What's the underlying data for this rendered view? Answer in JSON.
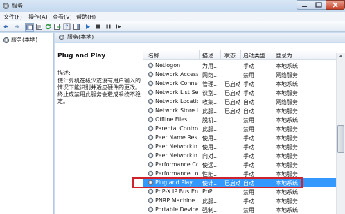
{
  "window": {
    "title": "服务"
  },
  "menu": [
    "文件(F)",
    "操作(A)",
    "查看(V)",
    "帮助(H)"
  ],
  "toolbar": {
    "icons": [
      "back-icon",
      "forward-icon",
      "console-tree-icon",
      "properties-icon",
      "refresh-icon",
      "export-icon",
      "help-icon",
      "show-hide-icon",
      "play-icon",
      "stop-icon",
      "pause-icon",
      "restart-icon"
    ]
  },
  "tree": {
    "label": "服务(本地)"
  },
  "header": {
    "title": "服务(本地)"
  },
  "details": {
    "title": "Plug and Play",
    "desc_label": "描述:",
    "description": "使计算机在极少或没有用户输入的情况下能识别并适应硬件的更改。终止或禁用此服务会造成系统不稳定。"
  },
  "columns": [
    "名称",
    "描述",
    "状态",
    "启动类型",
    "登录为"
  ],
  "rows": [
    {
      "name": "Netlogon",
      "desc": "为用...",
      "status": "",
      "startup": "手动",
      "logon": "本地系统"
    },
    {
      "name": "Network Access ...",
      "desc": "网络...",
      "status": "",
      "startup": "禁用",
      "logon": "网络服务"
    },
    {
      "name": "Network Connec...",
      "desc": "管理...",
      "status": "已启动",
      "startup": "手动",
      "logon": "本地系统"
    },
    {
      "name": "Network List Ser...",
      "desc": "识别...",
      "status": "已启动",
      "startup": "手动",
      "logon": "本地服务"
    },
    {
      "name": "Network Locatio...",
      "desc": "收集...",
      "status": "已启动",
      "startup": "自动",
      "logon": "网络服务"
    },
    {
      "name": "Network Store I...",
      "desc": "此服...",
      "status": "已启动",
      "startup": "自动",
      "logon": "本地服务"
    },
    {
      "name": "Offline Files",
      "desc": "脱机...",
      "status": "",
      "startup": "禁用",
      "logon": "本地系统"
    },
    {
      "name": "Parental Controls",
      "desc": "此服...",
      "status": "",
      "startup": "禁用",
      "logon": "本地服务"
    },
    {
      "name": "Peer Name Res...",
      "desc": "使用...",
      "status": "",
      "startup": "手动",
      "logon": "本地服务"
    },
    {
      "name": "Peer Networkin...",
      "desc": "使用...",
      "status": "",
      "startup": "手动",
      "logon": "本地服务"
    },
    {
      "name": "Peer Networkin...",
      "desc": "向对...",
      "status": "",
      "startup": "手动",
      "logon": "本地服务"
    },
    {
      "name": "Performance Co...",
      "desc": "使远...",
      "status": "",
      "startup": "手动",
      "logon": "本地服务"
    },
    {
      "name": "Performance Lo...",
      "desc": "性能...",
      "status": "",
      "startup": "手动",
      "logon": "本地服务"
    },
    {
      "name": "Plug and Play",
      "desc": "使计...",
      "status": "已启动",
      "startup": "自动",
      "logon": "本地系统"
    },
    {
      "name": "PnP-X IP Bus En...",
      "desc": "PnP...",
      "status": "",
      "startup": "禁用",
      "logon": "本地系统"
    },
    {
      "name": "PNRP Machine ...",
      "desc": "此服...",
      "status": "",
      "startup": "手动",
      "logon": "本地服务"
    },
    {
      "name": "Portable Device ...",
      "desc": "强制...",
      "status": "",
      "startup": "禁用",
      "logon": "本地系统"
    }
  ],
  "selected_index": 13
}
